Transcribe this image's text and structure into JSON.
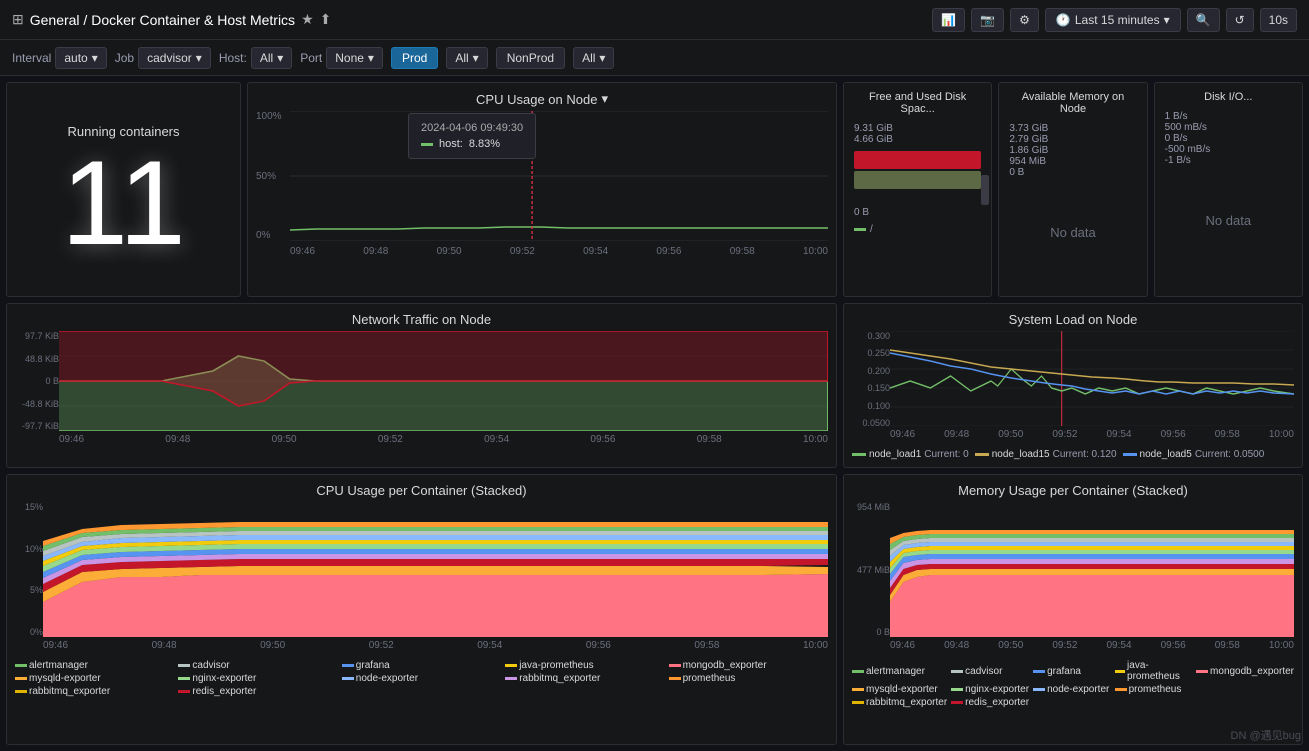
{
  "topbar": {
    "breadcrumb_prefix": "General / ",
    "title": "Docker Container & Host Metrics",
    "star_icon": "★",
    "share_icon": "⬆",
    "buttons": [
      {
        "label": "📊",
        "name": "graph-button"
      },
      {
        "label": "📷",
        "name": "camera-button"
      },
      {
        "label": "⚙",
        "name": "settings-button"
      }
    ],
    "time_range": "Last 15 minutes",
    "zoom_icon": "🔍",
    "refresh_icon": "↺",
    "refresh_interval": "10s"
  },
  "filters": [
    {
      "label": "Interval",
      "value": "auto",
      "has_dropdown": true
    },
    {
      "label": "Job",
      "value": "cadvisor",
      "has_dropdown": true
    },
    {
      "label": "Host:",
      "value": "All",
      "has_dropdown": true
    },
    {
      "label": "Port",
      "value": "None",
      "has_dropdown": true
    },
    {
      "label": "Prod",
      "value": "",
      "has_dropdown": false,
      "is_button": true
    },
    {
      "label": "All",
      "value": "",
      "has_dropdown": true,
      "after_prod": true
    },
    {
      "label": "NonProd",
      "value": "",
      "has_dropdown": false,
      "is_button": true
    },
    {
      "label": "All",
      "value": "",
      "has_dropdown": true,
      "after_nonprod": true
    }
  ],
  "panels": {
    "running_containers": {
      "title": "Running containers",
      "value": "11"
    },
    "cpu_usage_node": {
      "title": "CPU Usage on Node",
      "y_labels": [
        "100%",
        "50%",
        "0%"
      ],
      "x_labels": [
        "09:46",
        "09:48",
        "09:50",
        "09:52",
        "09:54",
        "09:56",
        "09:58",
        "10:00"
      ],
      "tooltip": {
        "date": "2024-04-06 09:49:30",
        "series": "host:",
        "value": "8.83%"
      }
    },
    "free_disk": {
      "title": "Free and Used Disk Spac...",
      "labels": [
        "9.31 GiB",
        "4.66 GiB",
        "0 B"
      ],
      "bar_label": "/",
      "legend_color": "#73bf69"
    },
    "available_memory": {
      "title": "Available Memory on Node",
      "labels": [
        "3.73 GiB",
        "2.79 GiB",
        "1.86 GiB",
        "954 MiB",
        "0 B"
      ],
      "no_data": "No data"
    },
    "disk_io": {
      "title": "Disk I/O...",
      "labels": [
        "1 B/s",
        "500 mB/s",
        "0 B/s",
        "-500 mB/s",
        "-1 B/s"
      ],
      "no_data": "No data"
    },
    "network_traffic": {
      "title": "Network Traffic on Node",
      "y_labels": [
        "97.7 KiB",
        "48.8 KiB",
        "0 B",
        "-48.8 KiB",
        "-97.7 KiB"
      ],
      "x_labels": [
        "09:46",
        "09:48",
        "09:50",
        "09:52",
        "09:54",
        "09:56",
        "09:58",
        "10:00"
      ]
    },
    "system_load": {
      "title": "System Load on Node",
      "y_labels": [
        "0.300",
        "0.250",
        "0.200",
        "0.150",
        "0.100",
        "0.0500"
      ],
      "x_labels": [
        "09:46",
        "09:48",
        "09:50",
        "09:52",
        "09:54",
        "09:56",
        "09:58",
        "10:00"
      ],
      "legend": [
        {
          "label": "node_load1",
          "current": "Current: 0",
          "color": "#73bf69"
        },
        {
          "label": "node_load15",
          "current": "Current: 0.120",
          "color": "#b8c4c2"
        },
        {
          "label": "node_load5",
          "current": "Current: 0.0500",
          "color": "#5794f2"
        }
      ]
    },
    "cpu_per_container": {
      "title": "CPU Usage per Container (Stacked)",
      "y_labels": [
        "15%",
        "10%",
        "5%",
        "0%"
      ],
      "x_labels": [
        "09:46",
        "09:48",
        "09:50",
        "09:52",
        "09:54",
        "09:56",
        "09:58",
        "10:00"
      ],
      "legend_row1": [
        {
          "label": "alertmanager",
          "color": "#73bf69"
        },
        {
          "label": "cadvisor",
          "color": "#b8c4c2"
        },
        {
          "label": "grafana",
          "color": "#5794f2"
        },
        {
          "label": "java-prometheus",
          "color": "#f2cc0c"
        },
        {
          "label": "mongodb_exporter",
          "color": "#ff7383"
        }
      ],
      "legend_row2": [
        {
          "label": "mysqld-exporter",
          "color": "#fbad37"
        },
        {
          "label": "nginx-exporter",
          "color": "#96d98d"
        },
        {
          "label": "node-exporter",
          "color": "#8ab8ff"
        },
        {
          "label": "rabbitmq_exporter",
          "color": "#ca95e5"
        },
        {
          "label": "prometheus",
          "color": "#ff9830"
        }
      ],
      "legend_row3": [
        {
          "label": "rabbitmq_exporter",
          "color": "#e0b400"
        },
        {
          "label": "redis_exporter",
          "color": "#c4162a"
        }
      ]
    },
    "memory_per_container": {
      "title": "Memory Usage per Container (Stacked)",
      "y_labels": [
        "954 MiB",
        "477 MiB",
        "0 B"
      ],
      "x_labels": [
        "09:46",
        "09:48",
        "09:50",
        "09:52",
        "09:54",
        "09:56",
        "09:58",
        "10:00"
      ],
      "legend_row1": [
        {
          "label": "alertmanager",
          "color": "#73bf69"
        },
        {
          "label": "cadvisor",
          "color": "#b8c4c2"
        },
        {
          "label": "grafana",
          "color": "#5794f2"
        },
        {
          "label": "java-prometheus",
          "color": "#f2cc0c"
        },
        {
          "label": "mongodb_exporter",
          "color": "#ff7383"
        }
      ],
      "legend_row2": [
        {
          "label": "mysqld-exporter",
          "color": "#fbad37"
        },
        {
          "label": "nginx-exporter",
          "color": "#96d98d"
        },
        {
          "label": "node-exporter",
          "color": "#8ab8ff"
        },
        {
          "label": "prometheus",
          "color": "#ff9830"
        }
      ],
      "legend_row3": [
        {
          "label": "rabbitmq_exporter",
          "color": "#e0b400"
        },
        {
          "label": "redis_exporter",
          "color": "#c4162a"
        }
      ]
    }
  },
  "watermark": "DN @遇见bug"
}
